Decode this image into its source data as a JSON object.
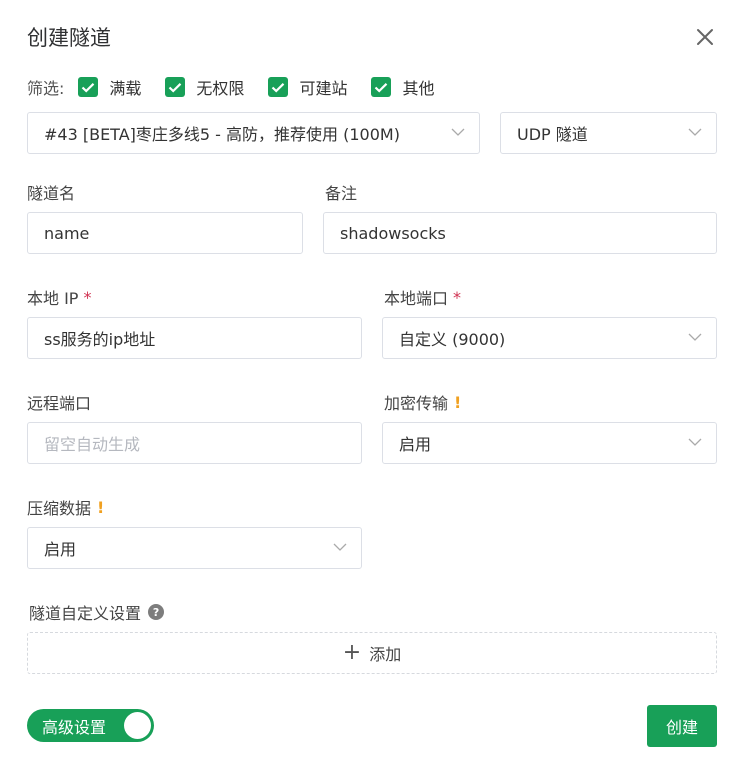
{
  "dialog": {
    "title": "创建隧道"
  },
  "filters": {
    "label": "筛选:",
    "options": [
      {
        "label": "满载",
        "checked": true
      },
      {
        "label": "无权限",
        "checked": true
      },
      {
        "label": "可建站",
        "checked": true
      },
      {
        "label": "其他",
        "checked": true
      }
    ]
  },
  "node_select": {
    "value": "#43 [BETA]枣庄多线5 - 高防，推荐使用 (100M)"
  },
  "type_select": {
    "value": "UDP 隧道"
  },
  "tunnel_name": {
    "label": "隧道名",
    "value": "name"
  },
  "remark": {
    "label": "备注",
    "value": "shadowsocks"
  },
  "local_ip": {
    "label": "本地 IP",
    "required_mark": "*",
    "value": "ss服务的ip地址"
  },
  "local_port": {
    "label": "本地端口",
    "required_mark": "*",
    "value": "自定义 (9000)"
  },
  "remote_port": {
    "label": "远程端口",
    "placeholder": "留空自动生成"
  },
  "encryption": {
    "label": "加密传输",
    "warn_mark": "!",
    "value": "启用"
  },
  "compression": {
    "label": "压缩数据",
    "warn_mark": "!",
    "value": "启用"
  },
  "custom_settings": {
    "label": "隧道自定义设置",
    "help_mark": "?",
    "add_label": "添加",
    "add_icon": "+"
  },
  "advanced_toggle": {
    "label": "高级设置",
    "on": true
  },
  "submit": {
    "label": "创建"
  },
  "colors": {
    "accent": "#18a058",
    "required": "#d03050",
    "warning": "#f0a020"
  }
}
